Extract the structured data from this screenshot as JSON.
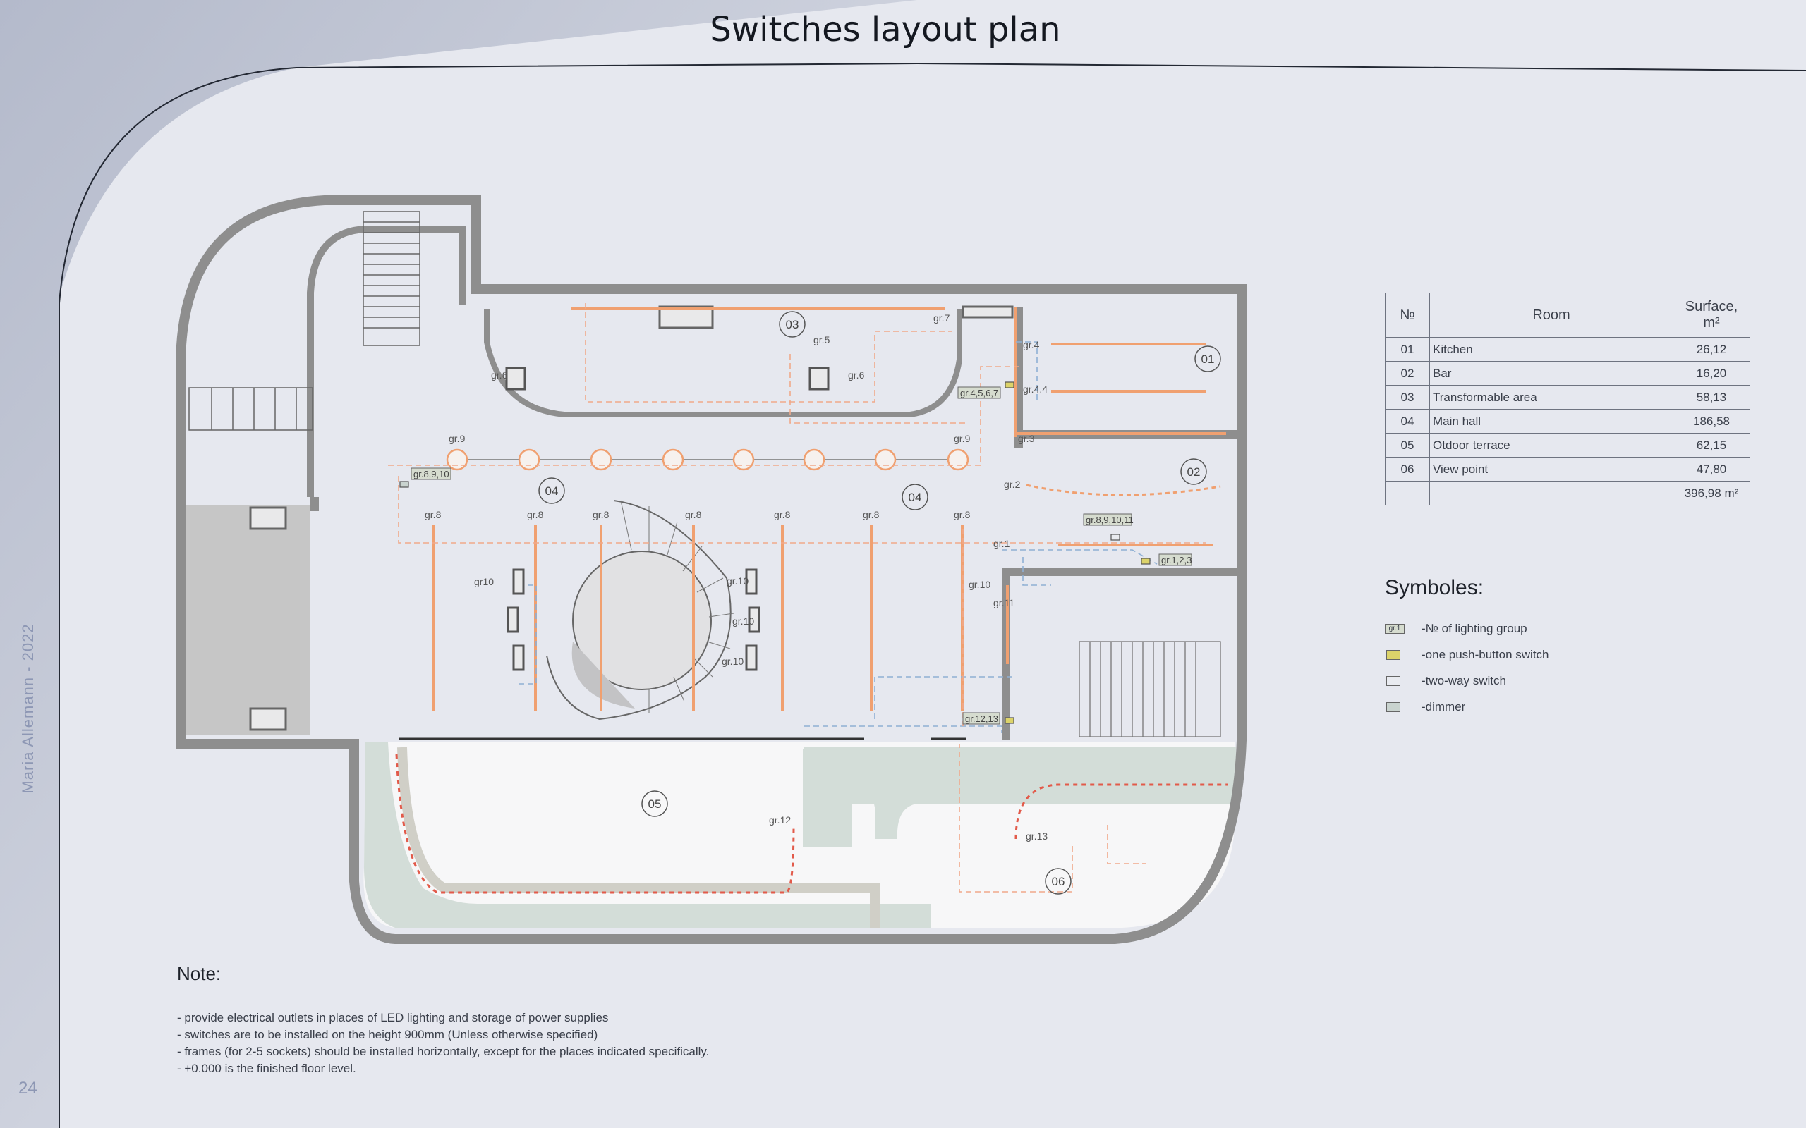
{
  "page": {
    "title": "Switches layout plan",
    "author": "Maria Allemann - 2022",
    "page_number": "24"
  },
  "plan": {
    "room_markers": [
      "01",
      "02",
      "03",
      "04",
      "04",
      "05",
      "06"
    ],
    "group_labels": {
      "g4": "gr.4",
      "g44": "gr.4.4",
      "g3": "gr.3",
      "g7": "gr.7",
      "g5": "gr.5",
      "g6a": "gr.6",
      "g6b": "gr.6",
      "g9a": "gr.9",
      "g9b": "gr.9",
      "g2": "gr.2",
      "g1": "gr.1",
      "g8a": "gr.8",
      "g8b": "gr.8",
      "g8c": "gr.8",
      "g8d": "gr.8",
      "g8e": "gr.8",
      "g8f": "gr.8",
      "g8g": "gr.8",
      "g10a": "gr10",
      "g10b": "gr.10",
      "g10c": "gr.10",
      "g10d": "gr.10",
      "g10e": "gr.10",
      "g11": "gr.11",
      "g12": "gr.12",
      "g13": "gr.13"
    },
    "switch_tags": {
      "t1": "gr.4,5,6,7",
      "t2": "gr.8,9,10",
      "t3": "gr.8,9,10,11",
      "t4": "gr.1,2,3",
      "t5": "gr.12,13"
    }
  },
  "rooms_table": {
    "headers": {
      "no": "№",
      "room": "Room",
      "surface": "Surface, m²"
    },
    "rows": [
      {
        "no": "01",
        "room": "Kitchen",
        "surface": "26,12"
      },
      {
        "no": "02",
        "room": "Bar",
        "surface": "16,20"
      },
      {
        "no": "03",
        "room": "Transformable area",
        "surface": "58,13"
      },
      {
        "no": "04",
        "room": "Main hall",
        "surface": "186,58"
      },
      {
        "no": "05",
        "room": "Otdoor terrace",
        "surface": "62,15"
      },
      {
        "no": "06",
        "room": "View point",
        "surface": "47,80"
      }
    ],
    "total": "396,98 m²"
  },
  "symbols": {
    "title": "Symboles:",
    "items": [
      {
        "swatch_color": "#d6dccf",
        "tag": "gr.1",
        "label": "-№ of lighting group"
      },
      {
        "swatch_color": "#dcd36a",
        "tag": "",
        "label": "-one push-button switch"
      },
      {
        "swatch_color": "#e9ebf0",
        "tag": "",
        "label": "-two-way switch"
      },
      {
        "swatch_color": "#c9d3cf",
        "tag": "",
        "label": "-dimmer"
      }
    ]
  },
  "notes": {
    "title": "Note:",
    "lines": [
      "- provide electrical outlets in places of LED lighting and storage of power supplies",
      "- switches are to be installed on the height 900mm (Unless otherwise specified)",
      "- frames (for 2-5 sockets) should be installed horizontally, except for the places indicated specifically.",
      "- +0.000 is the finished floor level."
    ]
  },
  "colors": {
    "wall": "#8e8e8e",
    "lighting": "#f0a070",
    "dashed_circuit_orange": "#f1a98a",
    "dashed_circuit_blue": "#8fb0d4",
    "greenery": "#d3ddd8"
  }
}
